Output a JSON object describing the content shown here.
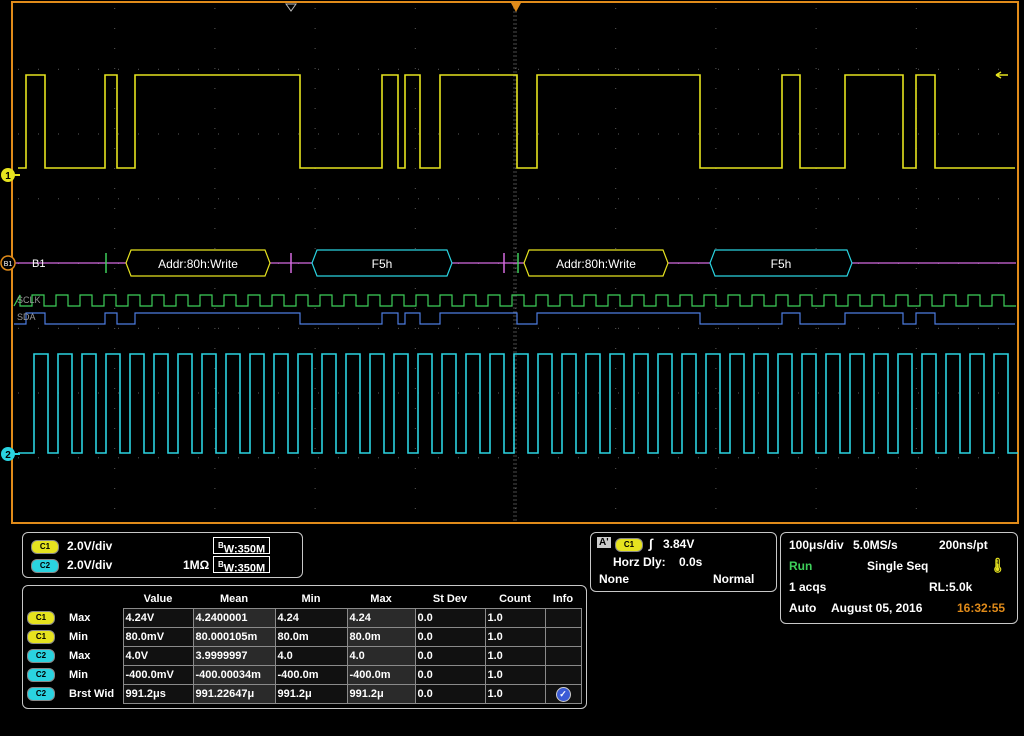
{
  "waveform": {
    "bus_label": "B1",
    "ch1_marker": "1",
    "ch2_marker": "2",
    "bus_marker": "B1",
    "sclk_label": "SCLK",
    "sda_label": "SDA",
    "decode": [
      {
        "text": "Addr:80h:Write",
        "color": "#e6e31f"
      },
      {
        "text": "F5h",
        "color": "#2ad3e0"
      },
      {
        "text": "Addr:80h:Write",
        "color": "#e6e31f"
      },
      {
        "text": "F5h",
        "color": "#2ad3e0"
      }
    ],
    "colors": {
      "ch1": "#e6e31f",
      "ch2": "#2ad3e0",
      "bus": "#d46adf",
      "sclk": "#3ecf5a",
      "sda": "#4d7ce0",
      "frame": "#e08b1a",
      "grid": "#5a5a5a"
    }
  },
  "channels": {
    "c1_label": "C1",
    "c1_scale": "2.0V/div",
    "c2_label": "C2",
    "c2_scale": "2.0V/div",
    "bw_label": "W:350M",
    "bw_prefix": "B",
    "c2_impedance": "1MΩ"
  },
  "trigger": {
    "a_label": "A'",
    "source": "C1",
    "level": "3.84V",
    "horz_dly_label": "Horz Dly:",
    "horz_dly": "0.0s",
    "coupling": "None",
    "mode": "Normal"
  },
  "acquisition": {
    "timebase": "100μs/div",
    "sample_rate": "5.0MS/s",
    "resolution": "200ns/pt",
    "state": "Run",
    "seq_mode": "Single Seq",
    "acqs": "1 acqs",
    "record_length": "RL:5.0k",
    "trigger_mode": "Auto",
    "date": "August 05, 2016",
    "time": "16:32:55"
  },
  "measurements": {
    "headers": [
      "Value",
      "Mean",
      "Min",
      "Max",
      "St Dev",
      "Count",
      "Info"
    ],
    "rows": [
      {
        "ch": "C1",
        "name": "Max",
        "value": "4.24V",
        "mean": "4.2400001",
        "min": "4.24",
        "max": "4.24",
        "stdev": "0.0",
        "count": "1.0"
      },
      {
        "ch": "C1",
        "name": "Min",
        "value": "80.0mV",
        "mean": "80.000105m",
        "min": "80.0m",
        "max": "80.0m",
        "stdev": "0.0",
        "count": "1.0"
      },
      {
        "ch": "C2",
        "name": "Max",
        "value": "4.0V",
        "mean": "3.9999997",
        "min": "4.0",
        "max": "4.0",
        "stdev": "0.0",
        "count": "1.0"
      },
      {
        "ch": "C2",
        "name": "Min",
        "value": "-400.0mV",
        "mean": "-400.00034m",
        "min": "-400.0m",
        "max": "-400.0m",
        "stdev": "0.0",
        "count": "1.0"
      },
      {
        "ch": "C2",
        "name": "Brst Wid",
        "value": "991.2μs",
        "mean": "991.22647μ",
        "min": "991.2μ",
        "max": "991.2μ",
        "stdev": "0.0",
        "count": "1.0"
      }
    ]
  }
}
